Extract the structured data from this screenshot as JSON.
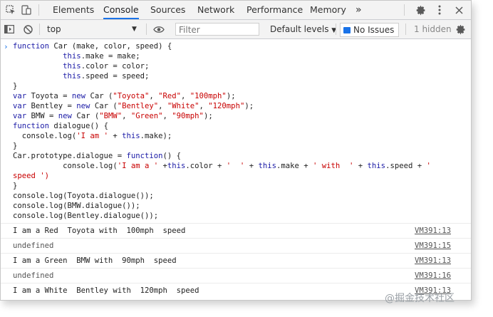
{
  "tabs": [
    {
      "label": "Elements"
    },
    {
      "label": "Console"
    },
    {
      "label": "Sources"
    },
    {
      "label": "Network"
    },
    {
      "label": "Performance"
    },
    {
      "label": "Memory"
    }
  ],
  "more_tabs_glyph": "»",
  "toolbar": {
    "context": "top",
    "filter_placeholder": "Filter",
    "levels": "Default levels",
    "issues": "No Issues",
    "hidden": "1 hidden"
  },
  "code_lines": [
    [
      [
        "kw2",
        "function"
      ],
      [
        "",
        "Car (make, color, speed) {"
      ]
    ],
    [
      [
        "",
        "           "
      ],
      [
        "kw2",
        "this"
      ],
      [
        "",
        ".make = make;"
      ]
    ],
    [
      [
        "",
        "           "
      ],
      [
        "kw2",
        "this"
      ],
      [
        "",
        ".color = color;"
      ]
    ],
    [
      [
        "",
        "           "
      ],
      [
        "kw2",
        "this"
      ],
      [
        "",
        ".speed = speed;"
      ]
    ],
    [
      [
        "",
        "}"
      ]
    ],
    [
      [
        "kw2",
        "var"
      ],
      [
        "",
        "Toyota = "
      ],
      [
        "kw2",
        "new"
      ],
      [
        "",
        "Car ("
      ],
      [
        "str",
        "\"Toyota\""
      ],
      [
        "",
        ", "
      ],
      [
        "str",
        "\"Red\""
      ],
      [
        "",
        ", "
      ],
      [
        "str",
        "\"100mph\""
      ],
      [
        "",
        ");"
      ]
    ],
    [
      [
        "kw2",
        "var"
      ],
      [
        "",
        "Bentley = "
      ],
      [
        "kw2",
        "new"
      ],
      [
        "",
        "Car ("
      ],
      [
        "str",
        "\"Bentley\""
      ],
      [
        "",
        ", "
      ],
      [
        "str",
        "\"White\""
      ],
      [
        "",
        ", "
      ],
      [
        "str",
        "\"120mph\""
      ],
      [
        "",
        ");"
      ]
    ],
    [
      [
        "kw2",
        "var"
      ],
      [
        "",
        "BMW = "
      ],
      [
        "kw2",
        "new"
      ],
      [
        "",
        "Car ("
      ],
      [
        "str",
        "\"BMW\""
      ],
      [
        "",
        ", "
      ],
      [
        "str",
        "\"Green\""
      ],
      [
        "",
        ", "
      ],
      [
        "str",
        "\"90mph\""
      ],
      [
        "",
        ");"
      ]
    ],
    [
      [
        "kw2",
        "function"
      ],
      [
        "",
        "dialogue() {"
      ]
    ],
    [
      [
        "",
        "  console.log("
      ],
      [
        "str",
        "'I am '"
      ],
      [
        "",
        " + "
      ],
      [
        "kw2",
        "this"
      ],
      [
        "",
        ".make);"
      ]
    ],
    [
      [
        "",
        "}"
      ]
    ],
    [
      [
        "",
        "Car.prototype.dialogue = "
      ],
      [
        "kw2",
        "function"
      ],
      [
        "",
        "() {"
      ]
    ],
    [
      [
        "",
        "           console.log("
      ],
      [
        "str",
        "'I am a '"
      ],
      [
        "",
        " +"
      ],
      [
        "kw2",
        "this"
      ],
      [
        "",
        ".color + "
      ],
      [
        "str",
        "'  '"
      ],
      [
        "",
        " + "
      ],
      [
        "kw2",
        "this"
      ],
      [
        "",
        ".make + "
      ],
      [
        "str",
        "' with  '"
      ],
      [
        "",
        " + "
      ],
      [
        "kw2",
        "this"
      ],
      [
        "",
        ".speed + "
      ],
      [
        "str",
        "'"
      ]
    ],
    [
      [
        "str",
        "speed ')"
      ]
    ],
    [
      [
        "",
        "}"
      ]
    ],
    [
      [
        "",
        "console.log(Toyota.dialogue());"
      ]
    ],
    [
      [
        "",
        "console.log(BMW.dialogue());"
      ]
    ],
    [
      [
        "",
        "console.log(Bentley.dialogue());"
      ]
    ]
  ],
  "messages": [
    {
      "text": "I am a Red  Toyota with  100mph  speed",
      "source": "VM391:13",
      "undef": false
    },
    {
      "text": "undefined",
      "source": "VM391:15",
      "undef": true
    },
    {
      "text": "I am a Green  BMW with  90mph  speed",
      "source": "VM391:13",
      "undef": false
    },
    {
      "text": "undefined",
      "source": "VM391:16",
      "undef": true
    },
    {
      "text": "I am a White  Bentley with  120mph  speed",
      "source": "VM391:13",
      "undef": false
    }
  ],
  "watermark": "@掘金技术社区"
}
